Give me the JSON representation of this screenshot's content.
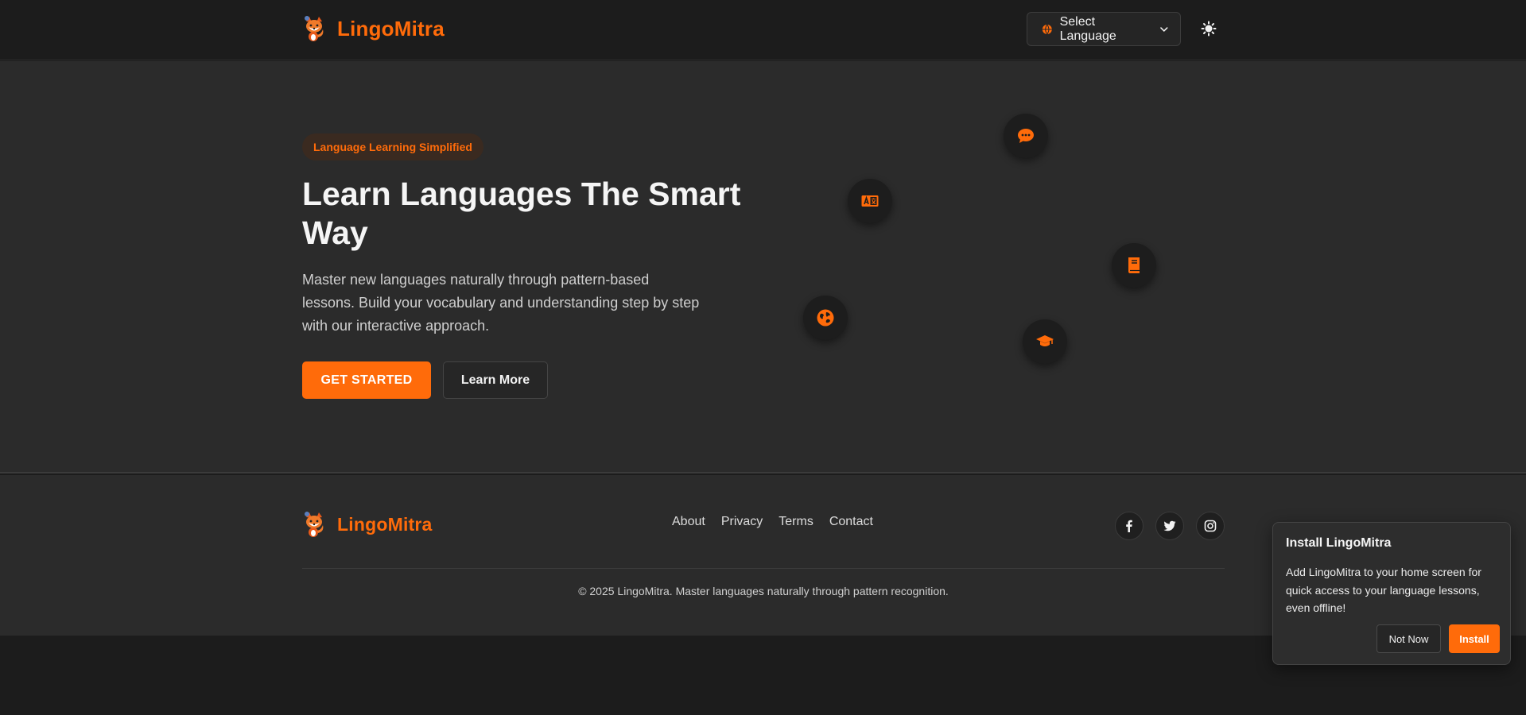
{
  "colors": {
    "accent": "#ff6b0a",
    "background": "#1c1c1c",
    "surface": "#2b2b2b"
  },
  "header": {
    "brand_name": "LingoMitra",
    "logo_icon": "fox-logo-icon",
    "language_select": {
      "label": "Select Language",
      "icon": "globe-icon"
    },
    "theme_toggle_icon": "sun-icon"
  },
  "hero": {
    "badge": "Language Learning Simplified",
    "title": "Learn Languages The Smart Way",
    "description": "Master new languages naturally through pattern-based lessons. Build your vocabulary and understanding step by step with our interactive approach.",
    "primary_button": "GET STARTED",
    "secondary_button": "Learn More",
    "floating_icons": [
      "chat-icon",
      "translate-icon",
      "book-icon",
      "globe-icon",
      "graduation-cap-icon"
    ]
  },
  "footer": {
    "brand_name": "LingoMitra",
    "links": [
      "About",
      "Privacy",
      "Terms",
      "Contact"
    ],
    "socials": [
      "facebook-icon",
      "twitter-icon",
      "instagram-icon"
    ],
    "copyright": "© 2025 LingoMitra. Master languages naturally through pattern recognition."
  },
  "install_prompt": {
    "title": "Install LingoMitra",
    "body": "Add LingoMitra to your home screen for quick access to your language lessons, even offline!",
    "dismiss_button": "Not Now",
    "install_button": "Install"
  }
}
